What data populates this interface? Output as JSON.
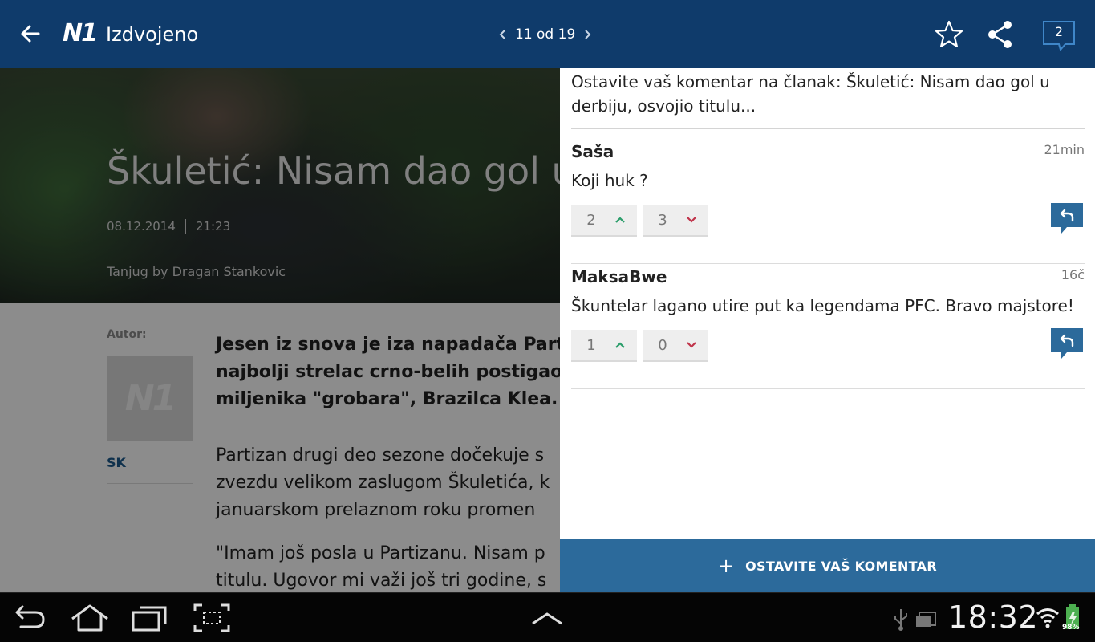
{
  "header": {
    "logo": "N1",
    "title": "Izdvojeno",
    "pager": "11 od 19",
    "comment_count": "2"
  },
  "article": {
    "hero_title": "Škuletić: Nisam dao gol u d",
    "date": "08.12.2014",
    "time": "21:23",
    "photo_credit": "Tanjug by Dragan Stankovic",
    "author_label": "Autor:",
    "author_avatar_text": "N1",
    "author_name": "SK",
    "lead": [
      "Jesen iz snova je iza napadača Parti",
      "najbolji strelac crno-belih postigao j",
      "miljenika \"grobara\", Brazilca Klea."
    ],
    "p1": [
      "Partizan drugi deo sezone dočekuje s",
      "zvezdu velikom zaslugom Škuletića, k",
      "januarskom prelaznom roku promen"
    ],
    "p2": [
      "\"Imam još posla u Partizanu. Nisam p",
      "titulu. Ugovor mi važi još tri godine, s"
    ]
  },
  "comments_panel": {
    "heading": "Ostavite vaš komentar na članak: Škuletić: Nisam dao gol u derbiju, osvojio titulu...",
    "comments": [
      {
        "author": "Saša",
        "time": "21min",
        "text": "Koji huk ?",
        "upvotes": "2",
        "downvotes": "3"
      },
      {
        "author": "MaksaBwe",
        "time": "16č",
        "text": "Škuntelar lagano utire put ka legendama PFC. Bravo majstore!",
        "upvotes": "1",
        "downvotes": "0"
      }
    ],
    "cta_label": "OSTAVITE VAŠ KOMENTAR"
  },
  "system_bar": {
    "clock": "18:32",
    "battery": "98%"
  },
  "colors": {
    "header_bg": "#0f3b6b",
    "cta_bg": "#2c6a9b",
    "upvote": "#2a9d6a",
    "downvote": "#c0334a"
  }
}
